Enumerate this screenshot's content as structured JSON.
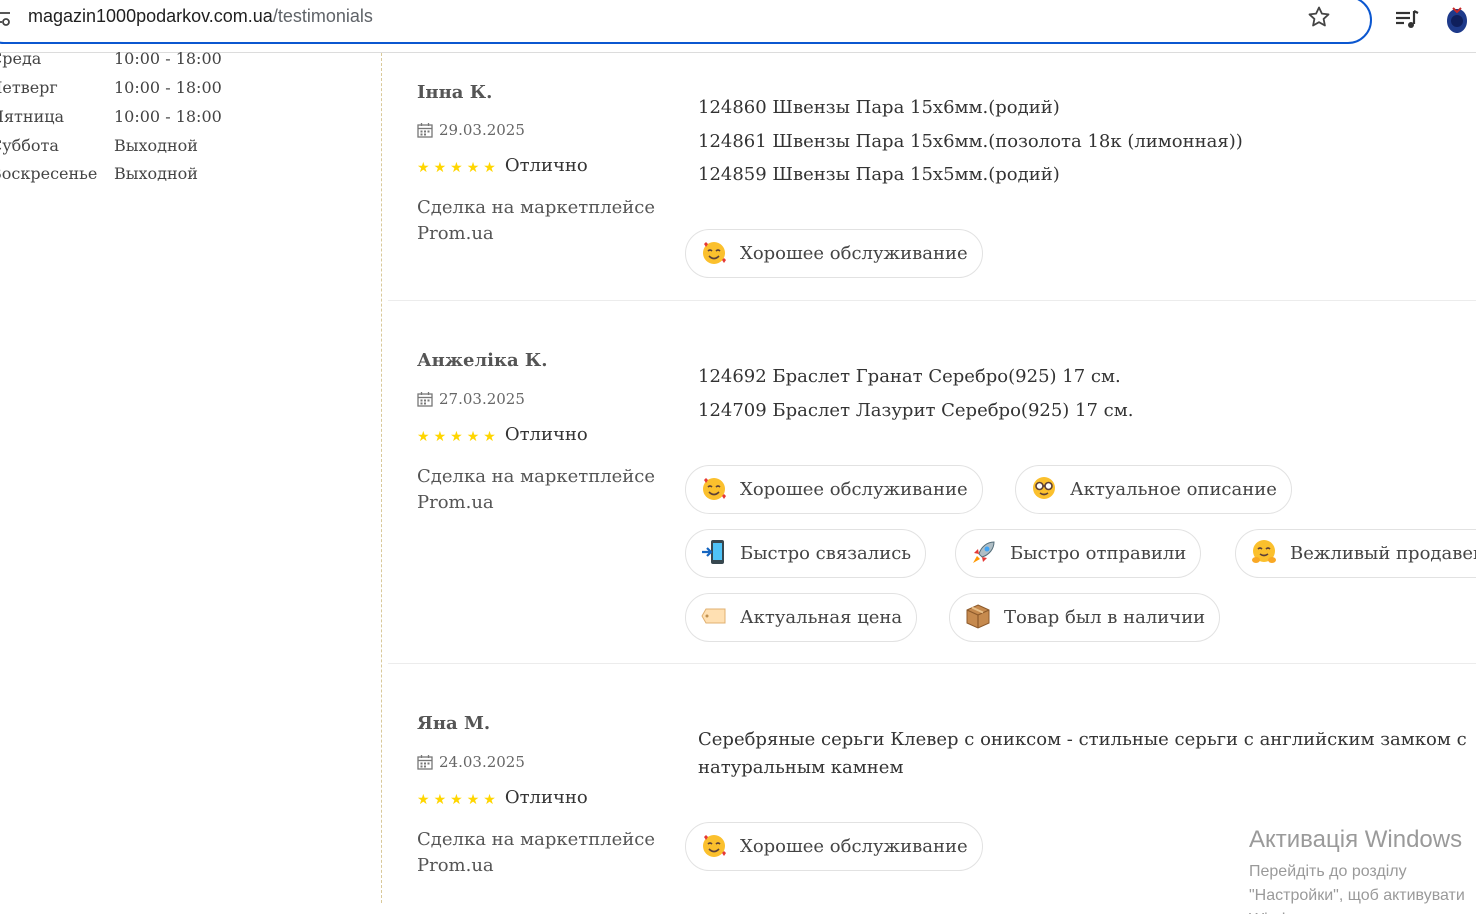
{
  "browser": {
    "url_host": "magazin1000podarkov.com.ua",
    "url_path": "/testimonials"
  },
  "schedule": [
    {
      "day": "Среда",
      "time": "10:00 - 18:00"
    },
    {
      "day": "Четверг",
      "time": "10:00 - 18:00"
    },
    {
      "day": "Пятница",
      "time": "10:00 - 18:00"
    },
    {
      "day": "Суббота",
      "time": "Выходной"
    },
    {
      "day": "Воскресенье",
      "time": "Выходной"
    }
  ],
  "reviews": [
    {
      "name": "Інна К.",
      "date": "29.03.2025",
      "rating_label": "Отлично",
      "rating": 5,
      "source": "Сделка на маркетплейсе Prom.ua",
      "products": [
        "124860 Швензы Пара 15х6мм.(родий)",
        "124861 Швензы Пара 15х6мм.(позолота 18к (лимонная))",
        "124859 Швензы Пара 15х5мм.(родий)"
      ],
      "tags": [
        {
          "icon": "smiling-face-with-hearts-icon",
          "label": "Хорошее обслуживание"
        }
      ]
    },
    {
      "name": "Анжеліка К.",
      "date": "27.03.2025",
      "rating_label": "Отлично",
      "rating": 5,
      "source": "Сделка на маркетплейсе Prom.ua",
      "products": [
        "124692 Браслет Гранат Серебро(925) 17 см.",
        "124709 Браслет Лазурит Серебро(925) 17 см."
      ],
      "tags": [
        {
          "icon": "smiling-face-with-hearts-icon",
          "label": "Хорошее обслуживание"
        },
        {
          "icon": "nerd-face-icon",
          "label": "Актуальное описание"
        },
        {
          "icon": "mobile-phone-arrow-icon",
          "label": "Быстро связались"
        },
        {
          "icon": "rocket-icon",
          "label": "Быстро отправили"
        },
        {
          "icon": "hugging-face-icon",
          "label": "Вежливый продавец"
        },
        {
          "icon": "price-tag-icon",
          "label": "Актуальная цена"
        },
        {
          "icon": "package-icon",
          "label": "Товар был в наличии"
        }
      ]
    },
    {
      "name": "Яна М.",
      "date": "24.03.2025",
      "rating_label": "Отлично",
      "rating": 5,
      "source": "Сделка на маркетплейсе Prom.ua",
      "product_text": "Серебряные серьги Клевер с ониксом - стильные серьги с английским замком с натуральным камнем",
      "tags": [
        {
          "icon": "smiling-face-with-hearts-icon",
          "label": "Хорошее обслуживание"
        }
      ]
    }
  ],
  "watermark": {
    "title": "Активація Windows",
    "subtitle": "Перейдіть до розділу \"Настройки\", щоб активувати Windows."
  }
}
